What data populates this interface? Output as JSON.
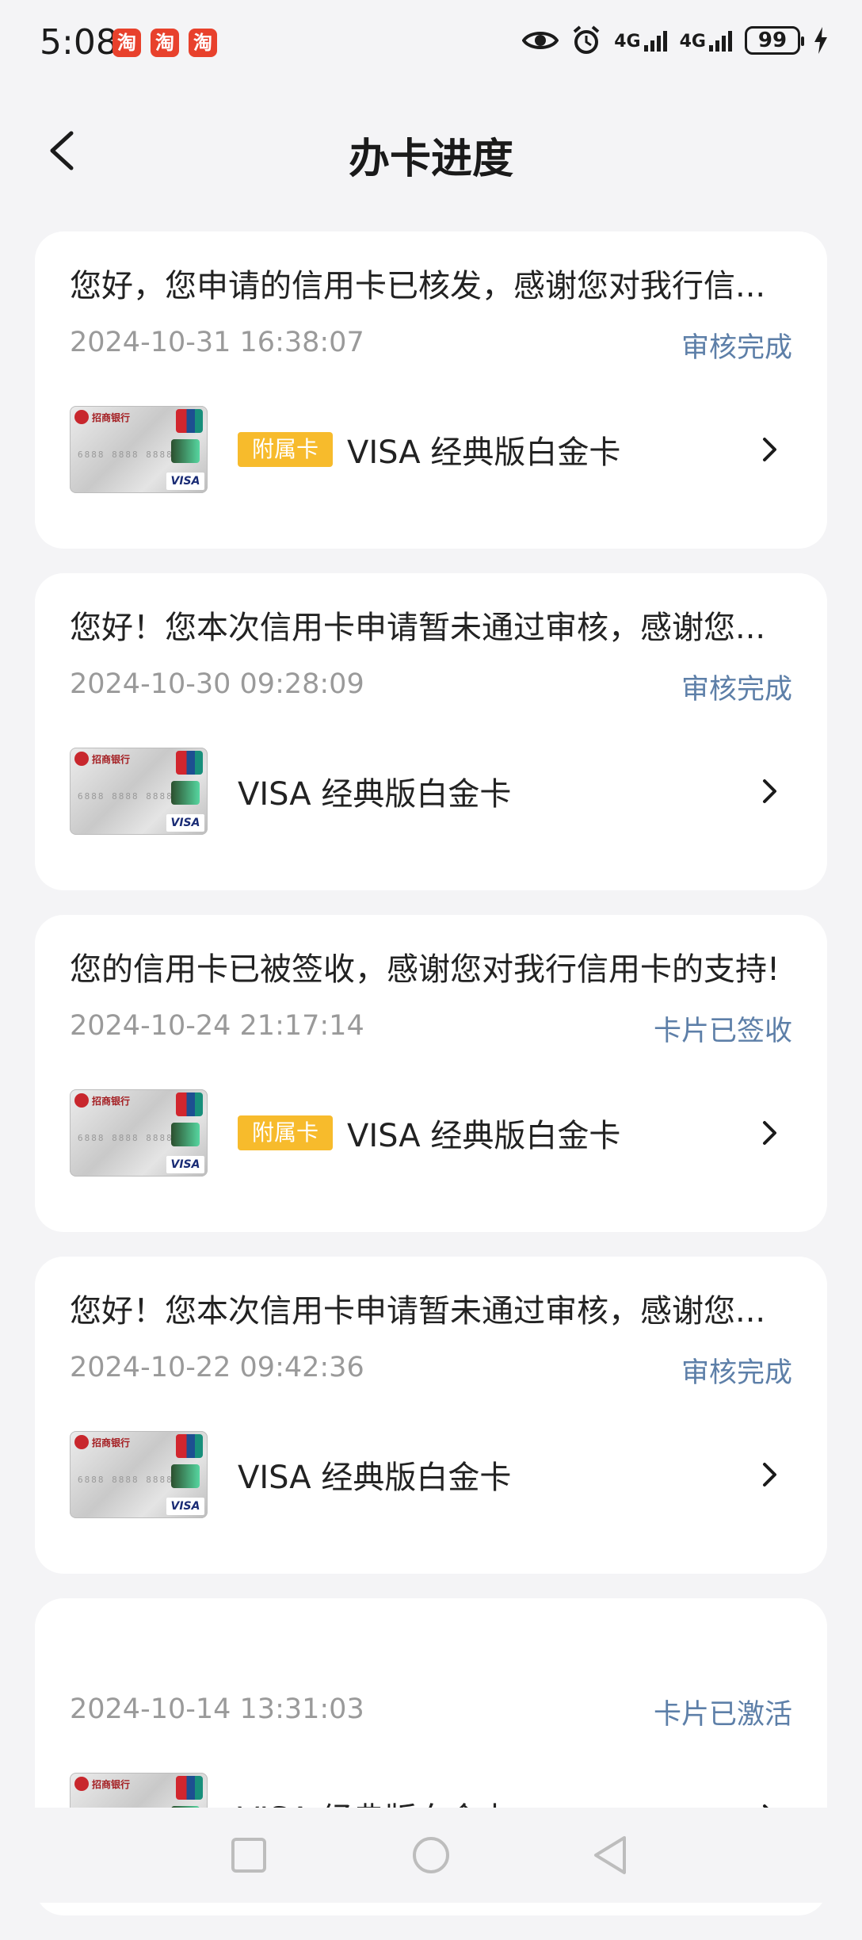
{
  "status_bar": {
    "time": "5:08",
    "app_badges": [
      "淘",
      "淘",
      "淘"
    ],
    "network": [
      "4G",
      "4G"
    ],
    "battery": "99"
  },
  "header": {
    "title": "办卡进度"
  },
  "cards": [
    {
      "message": "您好，您申请的信用卡已核发，感谢您对我行信...",
      "date": "2024-10-31 16:38:07",
      "status": "审核完成",
      "tag": "附属卡",
      "card_name": "VISA 经典版白金卡"
    },
    {
      "message": "您好！您本次信用卡申请暂未通过审核，感谢您...",
      "date": "2024-10-30 09:28:09",
      "status": "审核完成",
      "tag": "",
      "card_name": "VISA 经典版白金卡"
    },
    {
      "message": "您的信用卡已被签收，感谢您对我行信用卡的支持!",
      "date": "2024-10-24 21:17:14",
      "status": "卡片已签收",
      "tag": "附属卡",
      "card_name": "VISA 经典版白金卡"
    },
    {
      "message": "您好！您本次信用卡申请暂未通过审核，感谢您...",
      "date": "2024-10-22 09:42:36",
      "status": "审核完成",
      "tag": "",
      "card_name": "VISA 经典版白金卡"
    },
    {
      "message": "",
      "date": "2024-10-14 13:31:03",
      "status": "卡片已激活",
      "tag": "",
      "card_name": "VISA 经典版白金卡"
    }
  ],
  "card_image": {
    "bank_name": "招商银行",
    "number": "6888 8888 8888",
    "network": "VISA"
  },
  "colors": {
    "status": "#5d7fa8",
    "tag": "#f7bb2c",
    "date": "#9a9a9a"
  }
}
